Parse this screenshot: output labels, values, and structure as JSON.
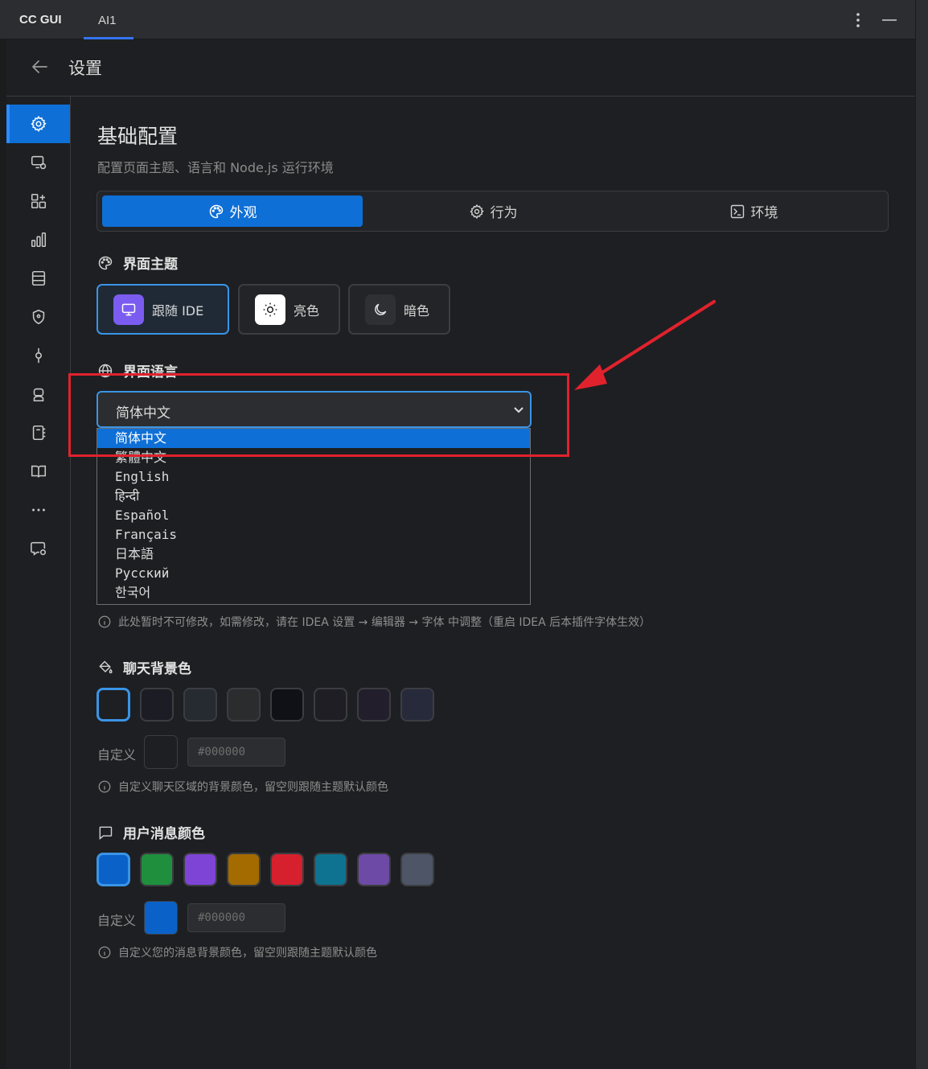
{
  "app": {
    "title": "CC GUI",
    "tab_label": "AI1"
  },
  "header": {
    "title": "设置"
  },
  "sidebar": {
    "items": [
      {
        "icon": "gear-icon",
        "active": true
      },
      {
        "icon": "monitor-settings-icon"
      },
      {
        "icon": "grid-plus-icon"
      },
      {
        "icon": "bar-chart-icon"
      },
      {
        "icon": "server-icon"
      },
      {
        "icon": "shield-icon"
      },
      {
        "icon": "commit-icon"
      },
      {
        "icon": "robot-icon"
      },
      {
        "icon": "notebook-icon"
      },
      {
        "icon": "book-open-icon"
      },
      {
        "icon": "more-dots-icon"
      },
      {
        "icon": "chat-settings-icon"
      }
    ]
  },
  "main": {
    "title": "基础配置",
    "description": "配置页面主题、语言和 Node.js 运行环境",
    "tabs": [
      {
        "label": "外观",
        "active": true
      },
      {
        "label": "行为"
      },
      {
        "label": "环境"
      }
    ],
    "theme": {
      "title": "界面主题",
      "options": [
        {
          "label": "跟随 IDE",
          "active": true
        },
        {
          "label": "亮色"
        },
        {
          "label": "暗色"
        }
      ]
    },
    "language": {
      "title": "界面语言",
      "selected": "简体中文",
      "options": [
        "简体中文",
        "繁體中文",
        "English",
        "हिन्दी",
        "Español",
        "Français",
        "日本語",
        "Русский",
        "한국어"
      ]
    },
    "font_hint": "此处暂时不可修改，如需修改，请在 IDEA 设置 → 编辑器 → 字体 中调整（重启 IDEA 后本插件字体生效）",
    "chat_bg": {
      "title": "聊天背景色",
      "swatches": [
        "#1e1f22",
        "#1b1c24",
        "#262a31",
        "#2b2c2e",
        "#0f1117",
        "#1e1e24",
        "#221e2b",
        "#262a3b"
      ],
      "custom_label": "自定义",
      "custom_color": "#1e1f22",
      "placeholder": "#000000",
      "hint": "自定义聊天区域的背景颜色，留空则跟随主题默认颜色"
    },
    "user_msg": {
      "title": "用户消息颜色",
      "swatches": [
        "#0a62c9",
        "#1f8f3e",
        "#7e44d6",
        "#a36b00",
        "#d6202e",
        "#0e7390",
        "#6e4aa7",
        "#4d5566"
      ],
      "custom_label": "自定义",
      "custom_color": "#0a62c9",
      "placeholder": "#000000",
      "hint": "自定义您的消息背景颜色，留空则跟随主题默认颜色"
    }
  }
}
